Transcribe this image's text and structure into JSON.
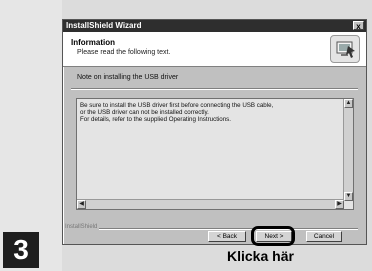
{
  "window": {
    "title": "InstallShield Wizard",
    "close_label": "x"
  },
  "header": {
    "title": "Information",
    "subtitle": "Please read the following text.",
    "icon": "installer-monitor-icon"
  },
  "main": {
    "note": "Note on installing the USB driver",
    "text_lines": [
      "Be sure to install the USB driver first before connecting the USB cable,",
      "or the USB driver can not be installed correctly.",
      "For details, refer to the supplied Operating Instructions."
    ]
  },
  "footer": {
    "brand": "InstallShield",
    "back_label": "< Back",
    "next_label": "Next >",
    "cancel_label": "Cancel"
  },
  "annotation": {
    "step_number": "3",
    "caption": "Klicka här"
  },
  "colors": {
    "titlebar": "#2e2e2e",
    "dialog": "#c0c0c0",
    "step_box": "#1e1e1e"
  }
}
